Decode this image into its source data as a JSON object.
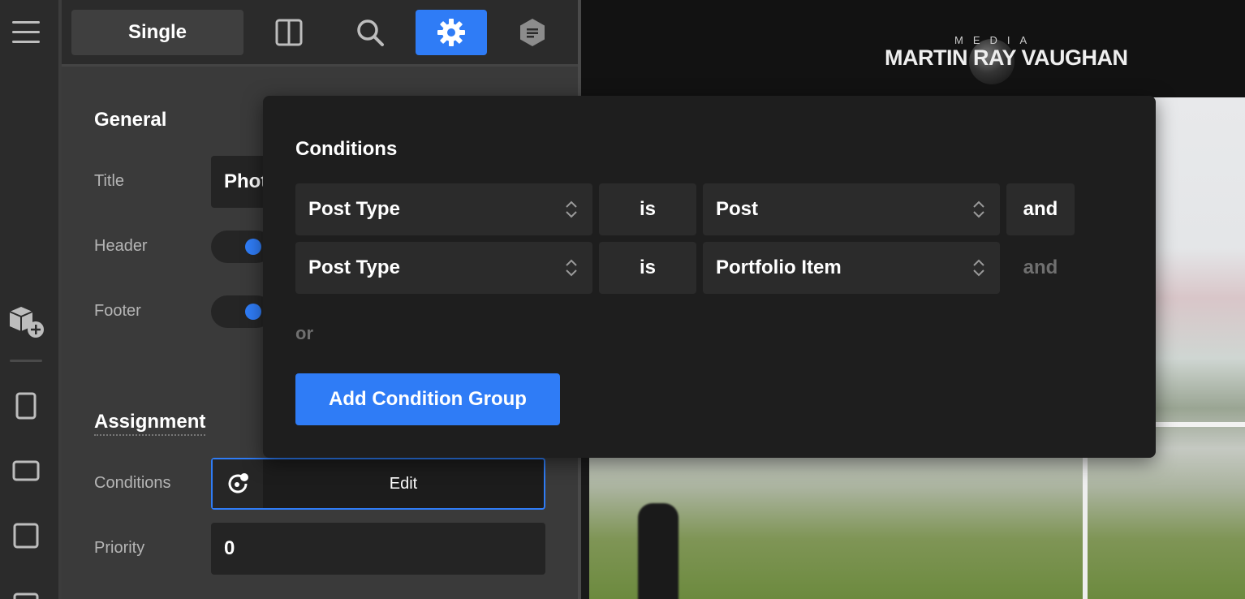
{
  "toolbar": {
    "single_label": "Single",
    "active_tab": "settings-icon"
  },
  "sidebar_rail": {
    "icons": [
      "menu-icon",
      "add-component-icon",
      "phone-frame-icon",
      "tablet-landscape-icon",
      "tablet-icon",
      "desktop-icon"
    ]
  },
  "general": {
    "heading": "General",
    "title_label": "Title",
    "title_value": "Phot",
    "header_label": "Header",
    "footer_label": "Footer"
  },
  "assignment": {
    "heading": "Assignment",
    "conditions_label": "Conditions",
    "edit_label": "Edit",
    "priority_label": "Priority",
    "priority_value": "0"
  },
  "site": {
    "logo_top": "MEDIA",
    "logo_main": "MARTIN RAY VAUGHAN"
  },
  "popup": {
    "title": "Conditions",
    "rows": [
      {
        "field": "Post Type",
        "operator": "is",
        "value": "Post",
        "conjunction": "and"
      },
      {
        "field": "Post Type",
        "operator": "is",
        "value": "Portfolio Item",
        "conjunction": "and"
      }
    ],
    "or_label": "or",
    "add_button": "Add Condition Group"
  },
  "colors": {
    "accent": "#2f7cf6",
    "panel_bg": "#3a3a3a",
    "popup_bg": "#1e1e1e"
  }
}
